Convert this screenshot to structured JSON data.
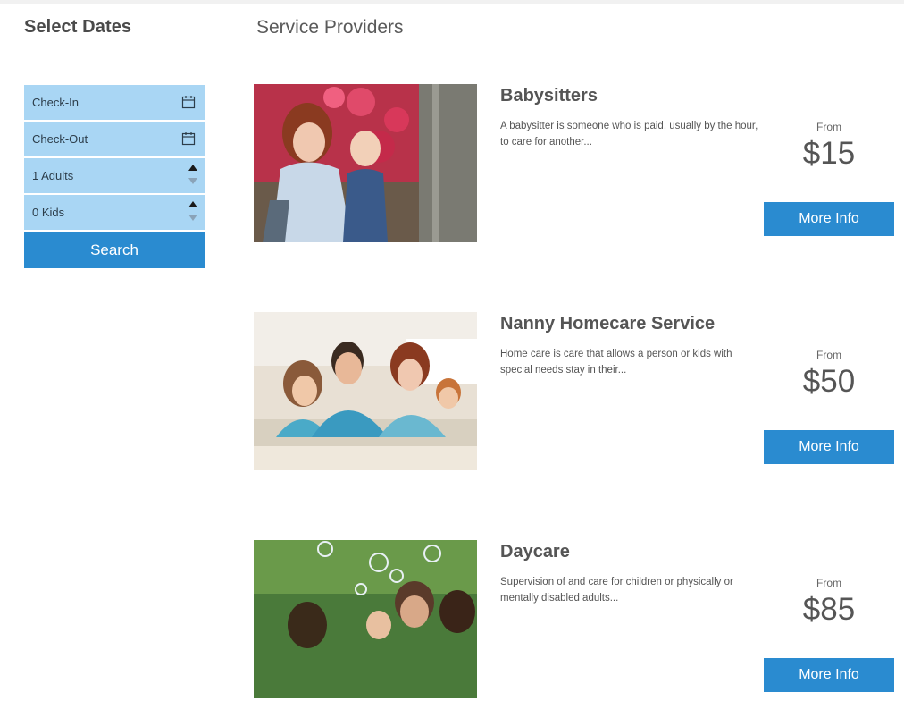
{
  "sidebar": {
    "title": "Select Dates",
    "checkin_label": "Check-In",
    "checkout_label": "Check-Out",
    "adults_label": "1 Adults",
    "kids_label": "0 Kids",
    "search_label": "Search"
  },
  "main": {
    "title": "Service Providers",
    "providers": [
      {
        "name": "Babysitters",
        "description": "A babysitter is someone who is paid, usually by the hour, to care for another...",
        "from_label": "From",
        "price": "$15",
        "button_label": "More Info"
      },
      {
        "name": "Nanny Homecare Service",
        "description": "Home care is care that allows a person or kids with special needs stay in their...",
        "from_label": "From",
        "price": "$50",
        "button_label": "More Info"
      },
      {
        "name": "Daycare",
        "description": "Supervision of and care for children or physically or mentally disabled adults...",
        "from_label": "From",
        "price": "$85",
        "button_label": "More Info"
      }
    ]
  },
  "colors": {
    "accent": "#2a8bd0",
    "filter_bg": "#a9d6f4",
    "text": "#555555"
  },
  "icons": [
    "calendar-icon",
    "arrow-up-icon",
    "arrow-down-icon"
  ]
}
